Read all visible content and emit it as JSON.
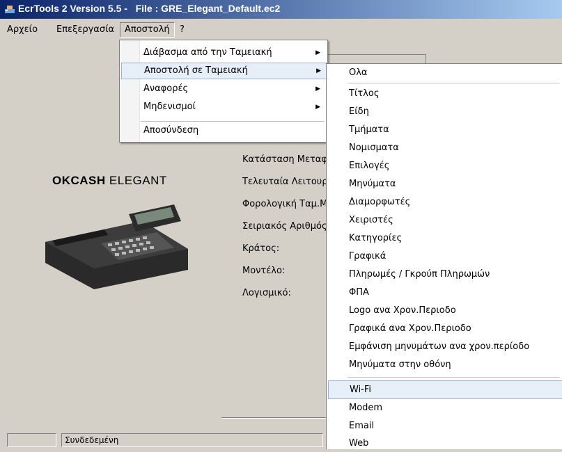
{
  "window": {
    "title": "EcrTools 2 Version 5.5 -   File : GRE_Elegant_Default.ec2"
  },
  "menubar": {
    "items": [
      "Αρχείο",
      "Επεξεργασία",
      "Αποστολή",
      "?"
    ]
  },
  "dropdown": {
    "items": [
      {
        "label": "Διάβασμα από την Ταμειακή",
        "submenu": true
      },
      {
        "label": "Αποστολή σε Ταμειακή",
        "submenu": true
      },
      {
        "label": "Αναφορές",
        "submenu": true
      },
      {
        "label": "Μηδενισμοί",
        "submenu": true
      },
      {
        "label": "Αποσύνδεση",
        "submenu": false
      }
    ]
  },
  "submenu": {
    "items": [
      "Ολα",
      "Τίτλος",
      "Είδη",
      "Τμήματα",
      "Νομισματα",
      "Επιλογές",
      "Μηνύματα",
      "Διαμορφωτές",
      "Χειριστές",
      "Κατηγορίες",
      "Γραφικά",
      "Πληρωμές / Γκρούπ Πληρωμών",
      "ΦΠΑ",
      "Logo ανα Χρον.Περιοδο",
      "Γραφικά ανα Χρον.Περιοδο",
      "Εμφάνιση μηνυμάτων ανα χρον.περίοδο",
      "Μηνύματα στην οθόνη",
      "Wi-Fi",
      "Modem",
      "Email",
      "Web"
    ]
  },
  "device": {
    "brand_bold": "OKCASH",
    "brand_light": " ELEGANT"
  },
  "info": {
    "labels": [
      "Κατάσταση Μεταφ",
      "Τελευταία Λειτουρ",
      "Φορολογική Ταμ.Μ",
      "Σειριακός Αριθμός",
      "Κράτος:",
      "Μοντέλο:",
      "Λογισμικό:"
    ]
  },
  "status": {
    "connection": "Συνδεδεμένη"
  },
  "colors": {
    "title_start": "#0a246a",
    "title_end": "#a6caf0",
    "menu_highlight": "#e6eef8"
  }
}
